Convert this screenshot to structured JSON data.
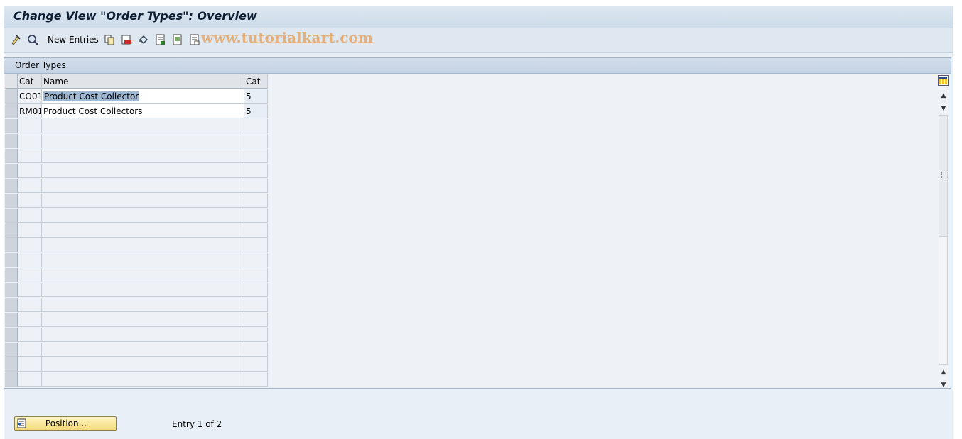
{
  "window": {
    "title": "Change View \"Order Types\": Overview"
  },
  "toolbar": {
    "new_entries_label": "New Entries",
    "icons": [
      "display-change-icon",
      "details-icon",
      "copy-as-icon",
      "delete-icon",
      "undo-change-icon",
      "select-all-icon",
      "select-block-icon",
      "deselect-all-icon"
    ],
    "watermark": "www.tutorialkart.com"
  },
  "panel": {
    "title": "Order Types",
    "columns": [
      "Cat",
      "Name",
      "Cat"
    ],
    "rows": [
      {
        "cat": "CO01",
        "name": "Product Cost Collector",
        "cat2": "5"
      },
      {
        "cat": "RM01",
        "name": "Product Cost Collectors",
        "cat2": "5"
      }
    ]
  },
  "footer": {
    "position_label": "Position...",
    "entry_info": "Entry 1 of 2"
  }
}
